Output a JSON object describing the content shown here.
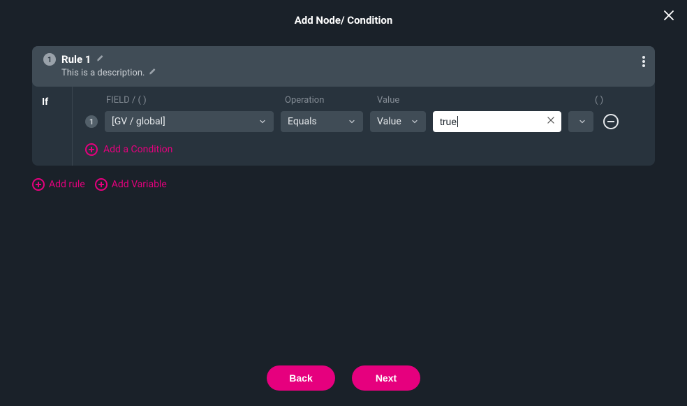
{
  "modal": {
    "title": "Add Node/ Condition"
  },
  "rule": {
    "index": "1",
    "title": "Rule 1",
    "description": "This is a description."
  },
  "condition": {
    "if_label": "If",
    "headers": {
      "field": "FIELD / ( )",
      "operation": "Operation",
      "value": "Value",
      "paren": "( )"
    },
    "row": {
      "index": "1",
      "field": "[GV / global]",
      "operation": "Equals",
      "value_type": "Value",
      "value_input": "true"
    },
    "add_condition_label": "Add a Condition"
  },
  "actions": {
    "add_rule": "Add rule",
    "add_variable": "Add Variable"
  },
  "footer": {
    "back": "Back",
    "next": "Next"
  }
}
